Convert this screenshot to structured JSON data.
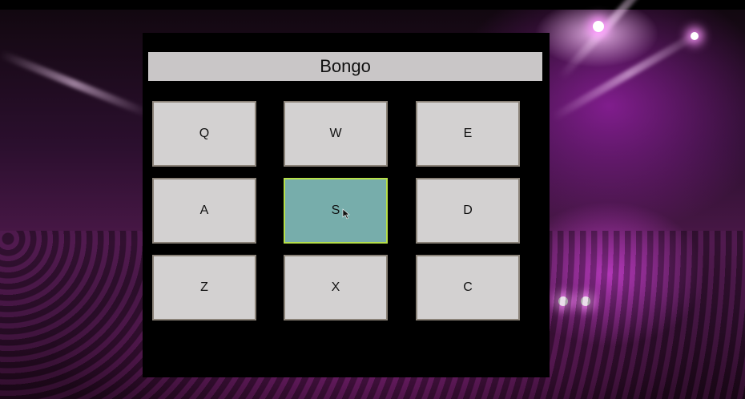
{
  "app": {
    "title": "Bongo"
  },
  "pads": [
    {
      "key": "Q",
      "active": false
    },
    {
      "key": "W",
      "active": false
    },
    {
      "key": "E",
      "active": false
    },
    {
      "key": "A",
      "active": false
    },
    {
      "key": "S",
      "active": true
    },
    {
      "key": "D",
      "active": false
    },
    {
      "key": "Z",
      "active": false
    },
    {
      "key": "X",
      "active": false
    },
    {
      "key": "C",
      "active": false
    }
  ],
  "colors": {
    "pad_default": "#d3d1d1",
    "pad_active": "#77adab",
    "pad_active_border": "#b6e04a",
    "title_bar": "#c9c6c7"
  },
  "icons": {
    "cursor": "mouse-pointer-icon"
  }
}
